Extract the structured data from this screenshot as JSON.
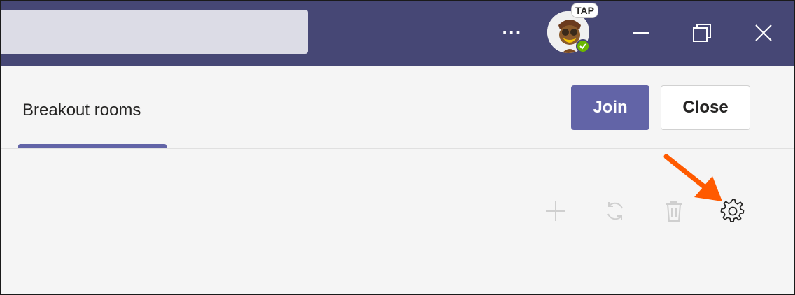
{
  "titlebar": {
    "search_value": "",
    "more_label": "···",
    "avatar_badge": "TAP",
    "presence": "available",
    "accent": "#464775"
  },
  "header": {
    "tab_title": "Breakout rooms",
    "join_label": "Join",
    "close_label": "Close",
    "join_color": "#6264a7"
  },
  "toolbar": {
    "icons": [
      "add-icon",
      "recreate-icon",
      "delete-icon",
      "settings-icon"
    ],
    "annotation_color": "#ff5a00"
  }
}
